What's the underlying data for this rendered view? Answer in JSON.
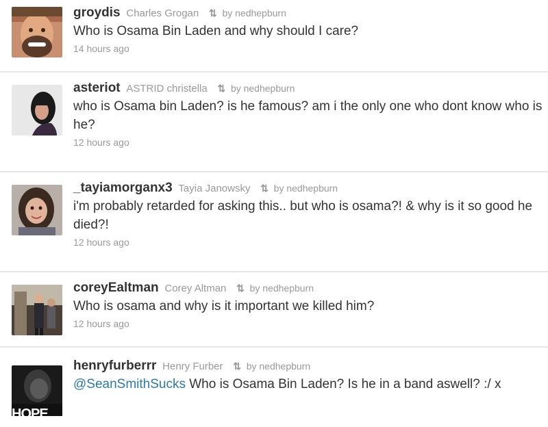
{
  "tweets": [
    {
      "screen_name": "groydis",
      "full_name": "Charles Grogan",
      "retweet_icon": "retweet-icon",
      "retweeted_by": "by nedhepburn",
      "text": "Who is Osama Bin Laden and why should I care?",
      "time": "14 hours ago",
      "avatar": "avatar-man-beard"
    },
    {
      "screen_name": "asteriot",
      "full_name": "ASTRID christella",
      "retweet_icon": "retweet-icon",
      "retweeted_by": "by nedhepburn",
      "text": "who is Osama bin Laden? is he famous? am i the only one who dont know who is he?",
      "time": "12 hours ago",
      "avatar": "avatar-woman-dark-hair"
    },
    {
      "screen_name": "_tayiamorganx3",
      "full_name": "Tayia Janowsky",
      "retweet_icon": "retweet-icon",
      "retweeted_by": "by nedhepburn",
      "text": "i'm probably retarded for asking this.. but who is osama?! & why is it so good he died?!",
      "time": "12 hours ago",
      "avatar": "avatar-girl-selfie"
    },
    {
      "screen_name": "coreyEaltman",
      "full_name": "Corey Altman",
      "retweet_icon": "retweet-icon",
      "retweeted_by": "by nedhepburn",
      "text": "Who is osama and why is it important we killed him?",
      "time": "12 hours ago",
      "avatar": "avatar-group-photo"
    },
    {
      "screen_name": "henryfurberrr",
      "full_name": "Henry Furber",
      "retweet_icon": "retweet-icon",
      "retweeted_by": "by nedhepburn",
      "mention": "@SeanSmithSucks",
      "text": " Who is Osama Bin Laden? Is he in a band aswell? :/ x",
      "time": "",
      "avatar": "avatar-hope-poster",
      "avatar_text": "HOPE"
    }
  ],
  "colors": {
    "name": "#333333",
    "meta": "#999999",
    "mention": "#2a7ab0",
    "divider": "#e6e6e6"
  }
}
